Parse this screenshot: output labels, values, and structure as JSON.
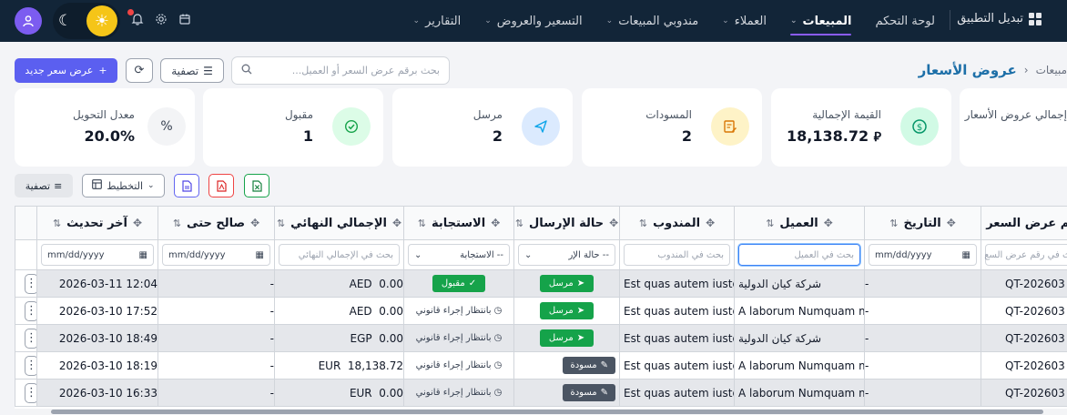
{
  "nav": {
    "brand": "تبديل التطبيق",
    "items": [
      {
        "label": "لوحة التحكم",
        "chev": ""
      },
      {
        "label": "المبيعات",
        "chev": "⌄"
      },
      {
        "label": "العملاء",
        "chev": "⌄"
      },
      {
        "label": "مندوبي المبيعات",
        "chev": "⌄"
      },
      {
        "label": "التسعير والعروض",
        "chev": "⌄"
      },
      {
        "label": "التقارير",
        "chev": "⌄"
      }
    ],
    "active_index": 1
  },
  "toolbar": {
    "new_label": "عرض سعر جديد",
    "filter_label": "تصفية",
    "search_placeholder": "بحث برقم عرض السعر أو العميل..."
  },
  "breadcrumb": {
    "parent": "مبيعات",
    "current": "عروض الأسعار"
  },
  "stats": [
    {
      "label": "إجمالي عروض الأسعار",
      "value": ""
    },
    {
      "label": "القيمة الإجمالية",
      "value": "18,138.72"
    },
    {
      "label": "المسودات",
      "value": "2"
    },
    {
      "label": "مرسل",
      "value": "2"
    },
    {
      "label": "مقبول",
      "value": "1"
    },
    {
      "label": "معدل التحويل",
      "value": "20.0%"
    }
  ],
  "table_toolbar": {
    "filter_label": "تصفية",
    "layout_label": "التخطيط"
  },
  "table": {
    "columns": [
      "رقم عرض السعر",
      "التاريخ",
      "العميل",
      "المندوب",
      "حالة الإرسال",
      "الاستجابة",
      "الإجمالي النهائي",
      "صالح حتى",
      "آخر تحديث"
    ],
    "filters": {
      "number_placeholder": "بحث في رقم عرض السع",
      "date_placeholder": "mm/dd/yyyy",
      "client_placeholder": "بحث في العميل",
      "rep_placeholder": "بحث في المندوب",
      "send_status_placeholder": "-- حالة الإر",
      "response_placeholder": "-- الاستجابة",
      "total_placeholder": "بحث في الإجمالي النهائي",
      "valid_placeholder": "mm/dd/yyyy",
      "updated_placeholder": "mm/dd/yyyy"
    },
    "rows": [
      {
        "number": "QT-202603",
        "date": "-",
        "client": "شركة كيان الدولية",
        "rep": "Est quas autem iusto",
        "send_status": "مرسل",
        "send_kind": "sent",
        "response": "مقبول",
        "resp_kind": "accepted",
        "total": "AED  0.00",
        "valid": "-",
        "updated": "2026-03-11 12:04"
      },
      {
        "number": "QT-202603",
        "date": "-",
        "client": "A laborum Numquam m",
        "rep": "Est quas autem iusto",
        "send_status": "مرسل",
        "send_kind": "sent",
        "response": "بانتظار إجراء قانوني",
        "resp_kind": "pending",
        "total": "AED  0.00",
        "valid": "-",
        "updated": "2026-03-10 17:52"
      },
      {
        "number": "QT-202603",
        "date": "-",
        "client": "شركة كيان الدولية",
        "rep": "Est quas autem iusto",
        "send_status": "مرسل",
        "send_kind": "sent",
        "response": "بانتظار إجراء قانوني",
        "resp_kind": "pending",
        "total": "EGP  0.00",
        "valid": "-",
        "updated": "2026-03-10 18:49"
      },
      {
        "number": "QT-202603",
        "date": "-",
        "client": "A laborum Numquam m",
        "rep": "Est quas autem iusto",
        "send_status": "مسودة",
        "send_kind": "draft",
        "response": "بانتظار إجراء قانوني",
        "resp_kind": "pending",
        "total": "EUR  18,138.72",
        "valid": "-",
        "updated": "2026-03-10 18:19"
      },
      {
        "number": "QT-202603",
        "date": "-",
        "client": "A laborum Numquam m",
        "rep": "Est quas autem iusto",
        "send_status": "مسودة",
        "send_kind": "draft",
        "response": "بانتظار إجراء قانوني",
        "resp_kind": "pending",
        "total": "EUR  0.00",
        "valid": "-",
        "updated": "2026-03-10 16:33"
      }
    ]
  },
  "colors": {
    "nav_bg": "#122538",
    "primary": "#5b5ff0",
    "accent": "#8b5cf6",
    "success": "#16a34a",
    "title": "#1d6fa8"
  }
}
